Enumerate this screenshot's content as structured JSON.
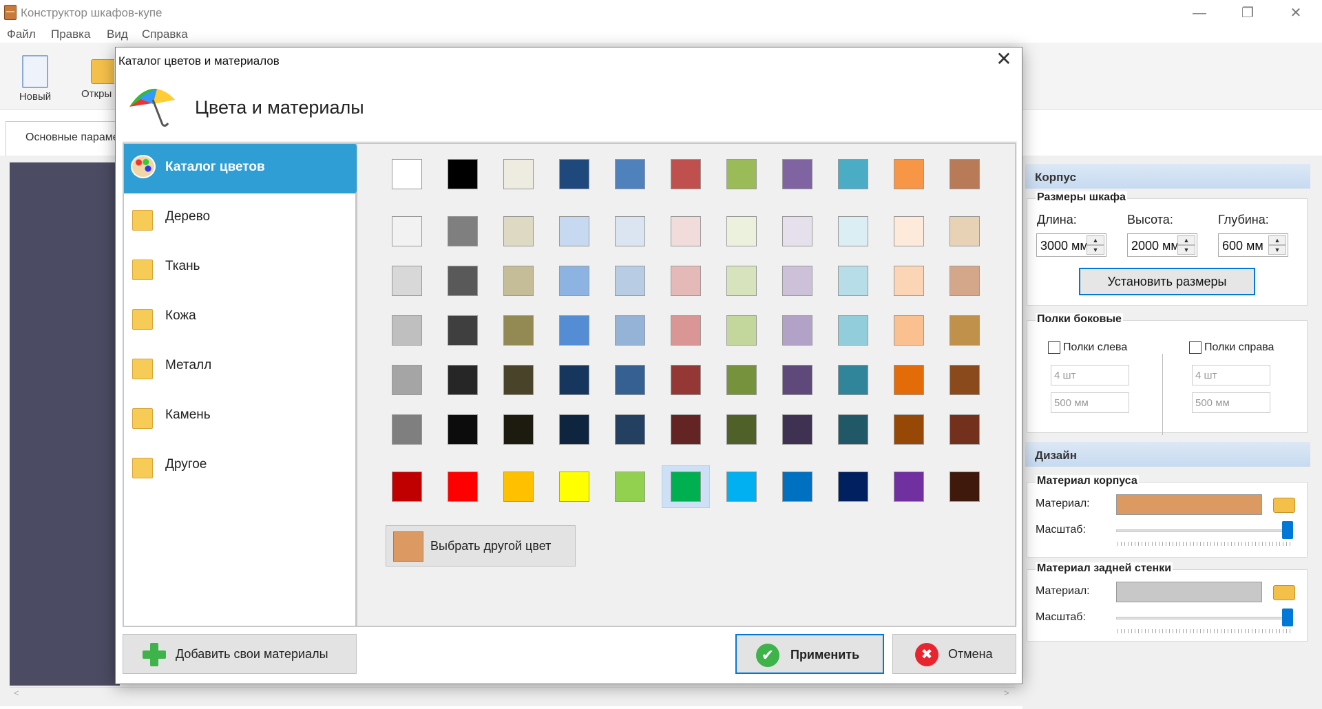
{
  "window": {
    "title": "Конструктор шкафов-купе",
    "controls": {
      "minimize": "—",
      "restore": "❐",
      "close": "✕"
    }
  },
  "menu": [
    "Файл",
    "Правка",
    "Вид",
    "Справка"
  ],
  "toolbar": {
    "new_label": "Новый",
    "open_label": "Откры"
  },
  "background_tab": {
    "label": "Основные парамет"
  },
  "scrollbar": {
    "left": "<",
    "right": ">"
  },
  "right_panel": {
    "korpus_header": "Корпус",
    "sizes": {
      "title": "Размеры шкафа",
      "length_label": "Длина:",
      "height_label": "Высота:",
      "depth_label": "Глубина:",
      "length_value": "3000 мм",
      "height_value": "2000 мм",
      "depth_value": "600 мм",
      "set_button": "Установить размеры"
    },
    "shelves": {
      "title": "Полки боковые",
      "left_label": "Полки слева",
      "right_label": "Полки справа",
      "left_count": "4 шт",
      "left_size": "500 мм",
      "right_count": "4 шт",
      "right_size": "500 мм"
    },
    "design_header": "Дизайн",
    "body_material": {
      "title": "Материал корпуса",
      "material_label": "Материал:",
      "scale_label": "Масштаб:",
      "color": "#dc9a62",
      "scale_percent": 98
    },
    "back_material": {
      "title": "Материал задней стенки",
      "material_label": "Материал:",
      "scale_label": "Масштаб:",
      "color": "#c8c8c8",
      "scale_percent": 98
    }
  },
  "dialog": {
    "title": "Каталог цветов и материалов",
    "close": "✕",
    "header": "Цвета и материалы",
    "categories": [
      {
        "label": "Каталог цветов",
        "active": true
      },
      {
        "label": "Дерево"
      },
      {
        "label": "Ткань"
      },
      {
        "label": "Кожа"
      },
      {
        "label": "Металл"
      },
      {
        "label": "Камень"
      },
      {
        "label": "Другое"
      }
    ],
    "palette": [
      [
        "#ffffff",
        "#000000",
        "#eeece1",
        "#1f497d",
        "#4f81bd",
        "#c0504d",
        "#9bbb59",
        "#8064a2",
        "#4bacc6",
        "#f79646",
        "#b97a57"
      ],
      [
        "#f2f2f2",
        "#7f7f7f",
        "#ddd9c3",
        "#c6d9f0",
        "#dbe5f1",
        "#f2dcdb",
        "#ebf1dd",
        "#e5e0ec",
        "#dbeef3",
        "#fdeada",
        "#e8d2b6"
      ],
      [
        "#d8d8d8",
        "#595959",
        "#c4bd97",
        "#8db3e2",
        "#b8cce4",
        "#e5b9b7",
        "#d7e3bc",
        "#ccc1d9",
        "#b7dde8",
        "#fbd5b5",
        "#d4a78b"
      ],
      [
        "#bfbfbf",
        "#3f3f3f",
        "#938953",
        "#548dd4",
        "#95b3d7",
        "#d99694",
        "#c3d69b",
        "#b2a2c7",
        "#92cddc",
        "#fac08f",
        "#c0914a"
      ],
      [
        "#a5a5a5",
        "#262626",
        "#494429",
        "#17365d",
        "#366092",
        "#953734",
        "#76923c",
        "#5f497a",
        "#31859b",
        "#e36c09",
        "#8a4a1c"
      ],
      [
        "#7f7f7f",
        "#0c0c0c",
        "#1d1b10",
        "#0f243e",
        "#244061",
        "#632423",
        "#4f6128",
        "#3f3151",
        "#205867",
        "#974806",
        "#73301c"
      ],
      [
        "#c00000",
        "#ff0000",
        "#ffc000",
        "#ffff00",
        "#92d050",
        "#00b050",
        "#00b0f0",
        "#0070c0",
        "#002060",
        "#7030a0",
        "#3f1a0c"
      ]
    ],
    "selected_swatch": {
      "row": 6,
      "col": 5
    },
    "other_color_button": "Выбрать другой цвет",
    "other_color": "#dc9a62",
    "add_materials_button": "Добавить свои материалы",
    "apply_button": "Применить",
    "cancel_button": "Отмена",
    "ok_glyph": "✔",
    "cancel_glyph": "✖"
  }
}
